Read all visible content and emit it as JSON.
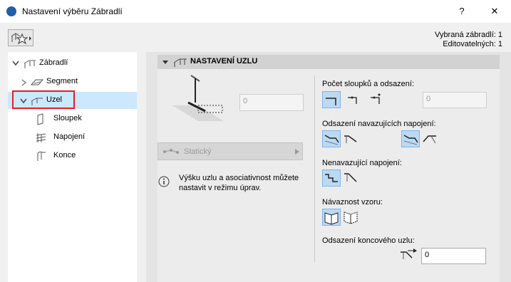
{
  "window": {
    "title": "Nastavení výběru Zábradlí",
    "help": "?",
    "close": "✕"
  },
  "info": {
    "selected": "Vybraná zábradlí: 1",
    "editable": "Editovatelných: 1"
  },
  "tree": {
    "items": [
      {
        "label": "Zábradlí",
        "icon": "railing-icon"
      },
      {
        "label": "Segment",
        "icon": "segment-icon"
      },
      {
        "label": "Uzel",
        "icon": "node-icon"
      },
      {
        "label": "Sloupek",
        "icon": "post-icon"
      },
      {
        "label": "Napojení",
        "icon": "connection-icon"
      },
      {
        "label": "Konce",
        "icon": "ends-icon"
      }
    ]
  },
  "section": {
    "title": "NASTAVENÍ UZLU"
  },
  "node": {
    "offset_value": "0",
    "mode": "Statický",
    "hint": "Výšku uzlu a asociativnost můžete nastavit v režimu úprav."
  },
  "right": {
    "posts_label": "Počet sloupků a odsazení:",
    "posts_value": "0",
    "adjacent_label": "Odsazení navazujících napojení:",
    "nonadjacent_label": "Nenavazující napojení:",
    "pattern_label": "Návaznost vzoru:",
    "end_offset_label": "Odsazení koncového uzlu:",
    "end_offset_value": "0"
  },
  "colors": {
    "selection": "#cce8ff",
    "highlight": "#e81c24",
    "active_button": "#bcd9f2"
  }
}
